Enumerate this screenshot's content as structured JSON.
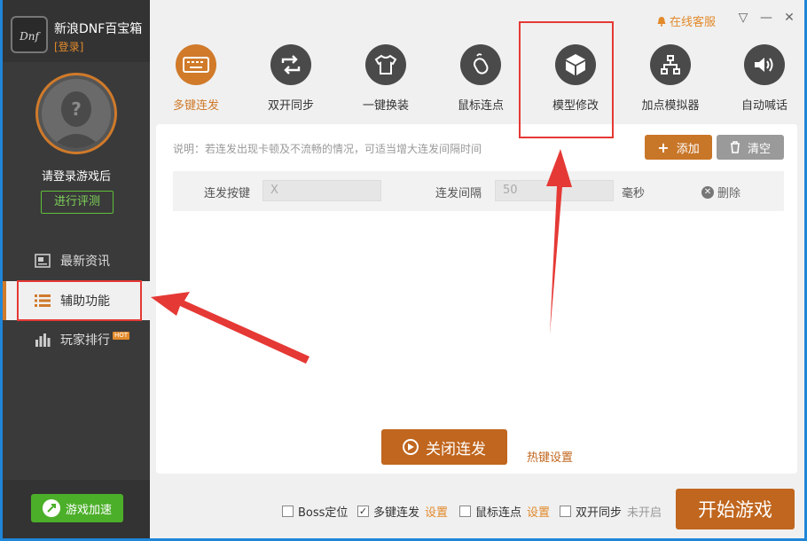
{
  "app": {
    "title": "新浪DNF百宝箱",
    "login_link": "[登录]"
  },
  "topbar": {
    "service_label": "在线客服",
    "dropdown_icon": "▽",
    "min_icon": "—",
    "close_icon": "✕"
  },
  "user": {
    "login_hint": "请登录游戏后",
    "eval_button": "进行评测"
  },
  "sidebar": {
    "items": [
      {
        "label": "最新资讯"
      },
      {
        "label": "辅助功能"
      },
      {
        "label": "玩家排行",
        "badge": "HOT"
      }
    ],
    "accelerate": "游戏加速"
  },
  "tools": [
    {
      "label": "多键连发",
      "icon": "keyboard-icon"
    },
    {
      "label": "双开同步",
      "icon": "sync-icon"
    },
    {
      "label": "一键换装",
      "icon": "shirt-icon"
    },
    {
      "label": "鼠标连点",
      "icon": "mouse-icon"
    },
    {
      "label": "模型修改",
      "icon": "cube-icon"
    },
    {
      "label": "加点模拟器",
      "icon": "tree-icon"
    },
    {
      "label": "自动喊话",
      "icon": "speaker-icon"
    }
  ],
  "panel": {
    "note": "说明：若连发出现卡顿及不流畅的情况，可适当增大连发间隔时间",
    "add": "添加",
    "clear": "清空",
    "row": {
      "key_label": "连发按键",
      "key_placeholder": "X",
      "interval_label": "连发间隔",
      "interval_value": "50",
      "unit": "毫秒",
      "delete": "删除"
    },
    "close_button": "关闭连发",
    "hotkey_link": "热键设置"
  },
  "bottom": {
    "options": [
      {
        "label": "Boss定位",
        "checked": false
      },
      {
        "label": "多键连发",
        "checked": true,
        "link": "设置"
      },
      {
        "label": "鼠标连点",
        "checked": false,
        "link": "设置"
      },
      {
        "label": "双开同步",
        "checked": false,
        "status": "未开启"
      }
    ],
    "start": "开始游戏"
  },
  "colors": {
    "accent": "#d07a2a",
    "annotation": "#e53935",
    "green": "#4caf2a"
  }
}
